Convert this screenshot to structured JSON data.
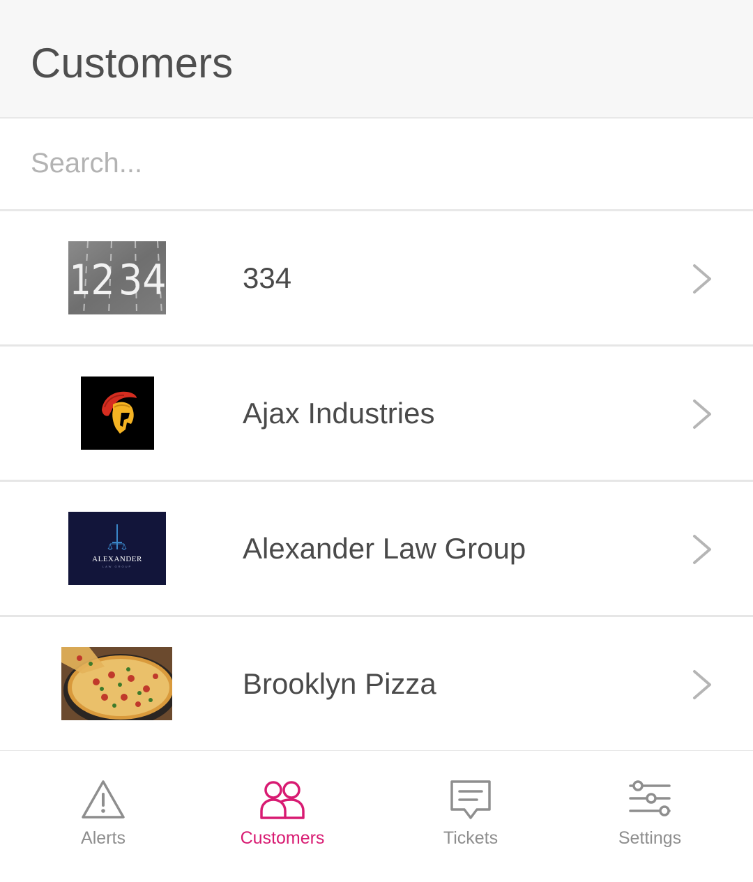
{
  "header": {
    "title": "Customers"
  },
  "search": {
    "placeholder": "Search..."
  },
  "customers": [
    {
      "name": "334",
      "logo": "road-numbers-image"
    },
    {
      "name": "Ajax Industries",
      "logo": "spartan-helmet-logo"
    },
    {
      "name": "Alexander Law Group",
      "logo": "alexander-law-logo",
      "logo_text": "ALEXANDER",
      "logo_subtext": "LAW GROUP"
    },
    {
      "name": "Brooklyn Pizza",
      "logo": "pizza-photo"
    }
  ],
  "tabs": [
    {
      "label": "Alerts",
      "icon": "warning-triangle-icon",
      "active": false
    },
    {
      "label": "Customers",
      "icon": "users-icon",
      "active": true
    },
    {
      "label": "Tickets",
      "icon": "chat-bubble-icon",
      "active": false
    },
    {
      "label": "Settings",
      "icon": "sliders-icon",
      "active": false
    }
  ],
  "colors": {
    "accent": "#d81b72",
    "inactive": "#8e8e8e",
    "text": "#4a4a4a",
    "divider": "#e6e6e6"
  }
}
